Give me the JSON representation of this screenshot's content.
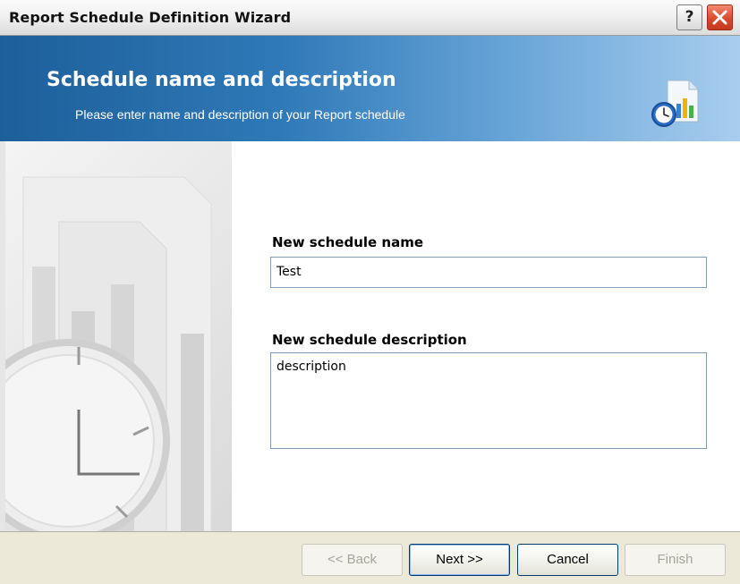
{
  "window": {
    "title": "Report Schedule Definition Wizard"
  },
  "banner": {
    "title": "Schedule name and description",
    "subtitle": "Please enter name and description of your Report schedule"
  },
  "form": {
    "name_label": "New schedule name",
    "name_value": "Test",
    "description_label": "New schedule description",
    "description_value": "description"
  },
  "buttons": {
    "back": "<< Back",
    "next": "Next >>",
    "cancel": "Cancel",
    "finish": "Finish"
  },
  "colors": {
    "banner_dark": "#1d5f99",
    "banner_light": "#a9cdee",
    "close_red": "#d84a2b"
  },
  "icons": [
    "help-icon",
    "close-icon",
    "report-schedule-icon",
    "clock-illustration-icon"
  ]
}
